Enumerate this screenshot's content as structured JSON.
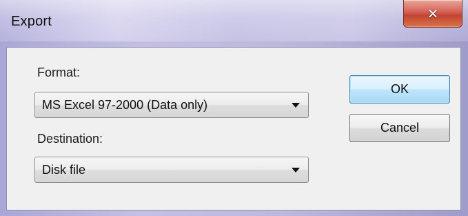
{
  "window": {
    "title": "Export",
    "close_icon": "close-icon",
    "close_glyph": "✕"
  },
  "form": {
    "format": {
      "label": "Format:",
      "selected": "MS Excel 97-2000 (Data only)"
    },
    "destination": {
      "label": "Destination:",
      "selected": "Disk file"
    }
  },
  "buttons": {
    "ok_label": "OK",
    "cancel_label": "Cancel"
  },
  "colors": {
    "close_button": "#c24432",
    "default_button_border": "#3c7fb1"
  }
}
